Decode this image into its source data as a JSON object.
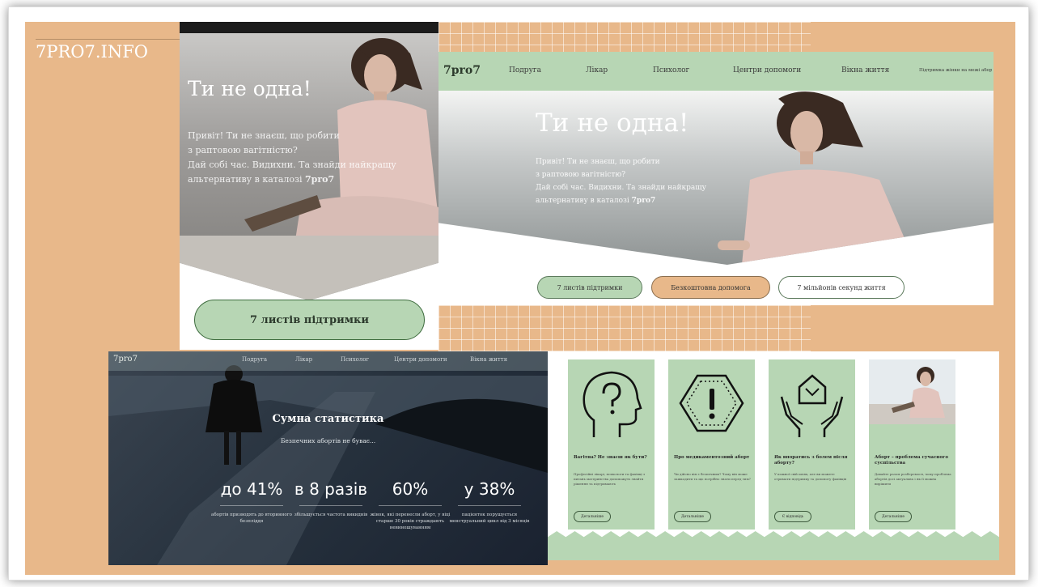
{
  "brand": {
    "logo": "7PRO7.INFO"
  },
  "mobile": {
    "title": "Ти не одна!",
    "intro_lines": [
      "Привіт! Ти не знаєш, що робити",
      "з раптовою вагітністю?",
      "Дай собі час. Видихни. Та знайди найкращу",
      "альтернативу в каталозі "
    ],
    "intro_brand": "7pro7",
    "cta": "7 листів підтримки"
  },
  "desktop": {
    "logo": "7pro7",
    "nav": [
      "Подруга",
      "Лікар",
      "Психолог",
      "Центри допомоги",
      "Вікна життя",
      "Підтримка жінки на межі абор"
    ],
    "title": "Ти не одна!",
    "intro_lines": [
      "Привіт! Ти не знаєш, що робити",
      "з раптовою вагітністю?",
      "Дай собі час. Видихни. Та знайди найкращу",
      "альтернативу в каталозі "
    ],
    "intro_brand": "7pro7",
    "pills": [
      "7 листів підтримки",
      "Безкоштовна допомога",
      "7 мільйонів секунд життя"
    ],
    "colors": {
      "mint": "#b7d6b4",
      "peach": "#e8b88a"
    }
  },
  "stats": {
    "logo": "7pro7",
    "nav": [
      "Подруга",
      "Лікар",
      "Психолог",
      "Центри допомоги",
      "Вікна життя"
    ],
    "title": "Сумна статистика",
    "subtitle": "Безпечних абортів не буває...",
    "items": [
      {
        "value": "до 41%",
        "desc": "абортів призводять до вторинного безпліддя"
      },
      {
        "value": "в 8 разів",
        "desc": "збільшується частота викиднів"
      },
      {
        "value": "60%",
        "desc": "жінок, які перенесли аборт, у віці старше 30 років страждають невиношуванням"
      },
      {
        "value": "у 38%",
        "desc": "пацієнток порушується менструальний цикл від 3 місяців"
      }
    ]
  },
  "cards": [
    {
      "icon": "head-question-icon",
      "title": "Вагітна? Не знаєш як бути?",
      "text": "Професійні лікарі, психологи та фахівці з питань материнства допоможуть знайти рішення та підтримають",
      "button": "Детальніше"
    },
    {
      "icon": "warning-octagon-icon",
      "title": "Про медикаментозний аборт",
      "text": "Чи дійсно він є безпечним? Чому він може зашкодити та що потрібно знати перед тим?",
      "button": "Детальніше"
    },
    {
      "icon": "hands-house-icon",
      "title": "Як впоратись з болем після аборту?",
      "text": "У кожної свій шлях, але ви можете отримати підтримку та допомогу фахівців",
      "button": "Є відповідь"
    },
    {
      "icon": "photo-woman",
      "title": "Аборт – проблема сучасного суспільства",
      "text": "Давайте разом розберемося, чому проблема абортів досі актуальна і як її можна вирішити",
      "button": "Детальніше"
    }
  ]
}
